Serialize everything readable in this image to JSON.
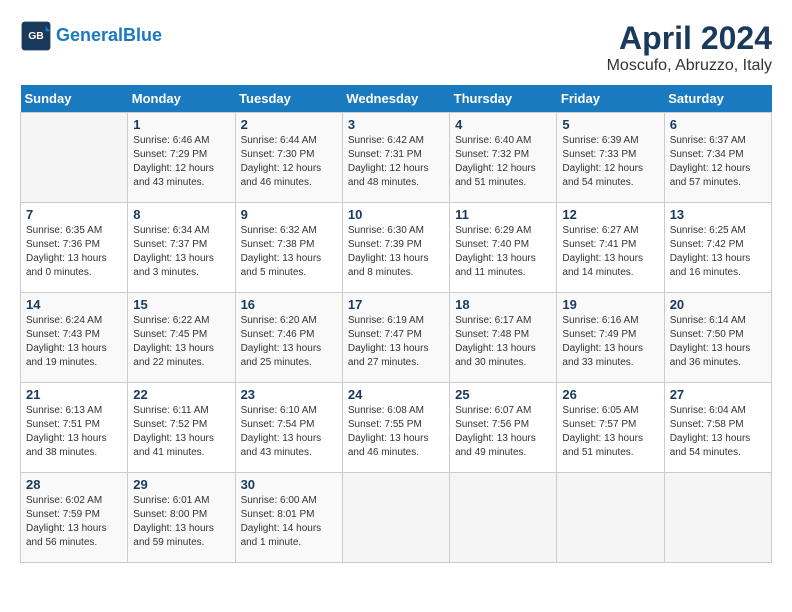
{
  "header": {
    "logo_line1": "General",
    "logo_line2": "Blue",
    "title": "April 2024",
    "subtitle": "Moscufo, Abruzzo, Italy"
  },
  "days_of_week": [
    "Sunday",
    "Monday",
    "Tuesday",
    "Wednesday",
    "Thursday",
    "Friday",
    "Saturday"
  ],
  "weeks": [
    [
      {
        "day": "",
        "info": ""
      },
      {
        "day": "1",
        "info": "Sunrise: 6:46 AM\nSunset: 7:29 PM\nDaylight: 12 hours\nand 43 minutes."
      },
      {
        "day": "2",
        "info": "Sunrise: 6:44 AM\nSunset: 7:30 PM\nDaylight: 12 hours\nand 46 minutes."
      },
      {
        "day": "3",
        "info": "Sunrise: 6:42 AM\nSunset: 7:31 PM\nDaylight: 12 hours\nand 48 minutes."
      },
      {
        "day": "4",
        "info": "Sunrise: 6:40 AM\nSunset: 7:32 PM\nDaylight: 12 hours\nand 51 minutes."
      },
      {
        "day": "5",
        "info": "Sunrise: 6:39 AM\nSunset: 7:33 PM\nDaylight: 12 hours\nand 54 minutes."
      },
      {
        "day": "6",
        "info": "Sunrise: 6:37 AM\nSunset: 7:34 PM\nDaylight: 12 hours\nand 57 minutes."
      }
    ],
    [
      {
        "day": "7",
        "info": "Sunrise: 6:35 AM\nSunset: 7:36 PM\nDaylight: 13 hours\nand 0 minutes."
      },
      {
        "day": "8",
        "info": "Sunrise: 6:34 AM\nSunset: 7:37 PM\nDaylight: 13 hours\nand 3 minutes."
      },
      {
        "day": "9",
        "info": "Sunrise: 6:32 AM\nSunset: 7:38 PM\nDaylight: 13 hours\nand 5 minutes."
      },
      {
        "day": "10",
        "info": "Sunrise: 6:30 AM\nSunset: 7:39 PM\nDaylight: 13 hours\nand 8 minutes."
      },
      {
        "day": "11",
        "info": "Sunrise: 6:29 AM\nSunset: 7:40 PM\nDaylight: 13 hours\nand 11 minutes."
      },
      {
        "day": "12",
        "info": "Sunrise: 6:27 AM\nSunset: 7:41 PM\nDaylight: 13 hours\nand 14 minutes."
      },
      {
        "day": "13",
        "info": "Sunrise: 6:25 AM\nSunset: 7:42 PM\nDaylight: 13 hours\nand 16 minutes."
      }
    ],
    [
      {
        "day": "14",
        "info": "Sunrise: 6:24 AM\nSunset: 7:43 PM\nDaylight: 13 hours\nand 19 minutes."
      },
      {
        "day": "15",
        "info": "Sunrise: 6:22 AM\nSunset: 7:45 PM\nDaylight: 13 hours\nand 22 minutes."
      },
      {
        "day": "16",
        "info": "Sunrise: 6:20 AM\nSunset: 7:46 PM\nDaylight: 13 hours\nand 25 minutes."
      },
      {
        "day": "17",
        "info": "Sunrise: 6:19 AM\nSunset: 7:47 PM\nDaylight: 13 hours\nand 27 minutes."
      },
      {
        "day": "18",
        "info": "Sunrise: 6:17 AM\nSunset: 7:48 PM\nDaylight: 13 hours\nand 30 minutes."
      },
      {
        "day": "19",
        "info": "Sunrise: 6:16 AM\nSunset: 7:49 PM\nDaylight: 13 hours\nand 33 minutes."
      },
      {
        "day": "20",
        "info": "Sunrise: 6:14 AM\nSunset: 7:50 PM\nDaylight: 13 hours\nand 36 minutes."
      }
    ],
    [
      {
        "day": "21",
        "info": "Sunrise: 6:13 AM\nSunset: 7:51 PM\nDaylight: 13 hours\nand 38 minutes."
      },
      {
        "day": "22",
        "info": "Sunrise: 6:11 AM\nSunset: 7:52 PM\nDaylight: 13 hours\nand 41 minutes."
      },
      {
        "day": "23",
        "info": "Sunrise: 6:10 AM\nSunset: 7:54 PM\nDaylight: 13 hours\nand 43 minutes."
      },
      {
        "day": "24",
        "info": "Sunrise: 6:08 AM\nSunset: 7:55 PM\nDaylight: 13 hours\nand 46 minutes."
      },
      {
        "day": "25",
        "info": "Sunrise: 6:07 AM\nSunset: 7:56 PM\nDaylight: 13 hours\nand 49 minutes."
      },
      {
        "day": "26",
        "info": "Sunrise: 6:05 AM\nSunset: 7:57 PM\nDaylight: 13 hours\nand 51 minutes."
      },
      {
        "day": "27",
        "info": "Sunrise: 6:04 AM\nSunset: 7:58 PM\nDaylight: 13 hours\nand 54 minutes."
      }
    ],
    [
      {
        "day": "28",
        "info": "Sunrise: 6:02 AM\nSunset: 7:59 PM\nDaylight: 13 hours\nand 56 minutes."
      },
      {
        "day": "29",
        "info": "Sunrise: 6:01 AM\nSunset: 8:00 PM\nDaylight: 13 hours\nand 59 minutes."
      },
      {
        "day": "30",
        "info": "Sunrise: 6:00 AM\nSunset: 8:01 PM\nDaylight: 14 hours\nand 1 minute."
      },
      {
        "day": "",
        "info": ""
      },
      {
        "day": "",
        "info": ""
      },
      {
        "day": "",
        "info": ""
      },
      {
        "day": "",
        "info": ""
      }
    ]
  ]
}
